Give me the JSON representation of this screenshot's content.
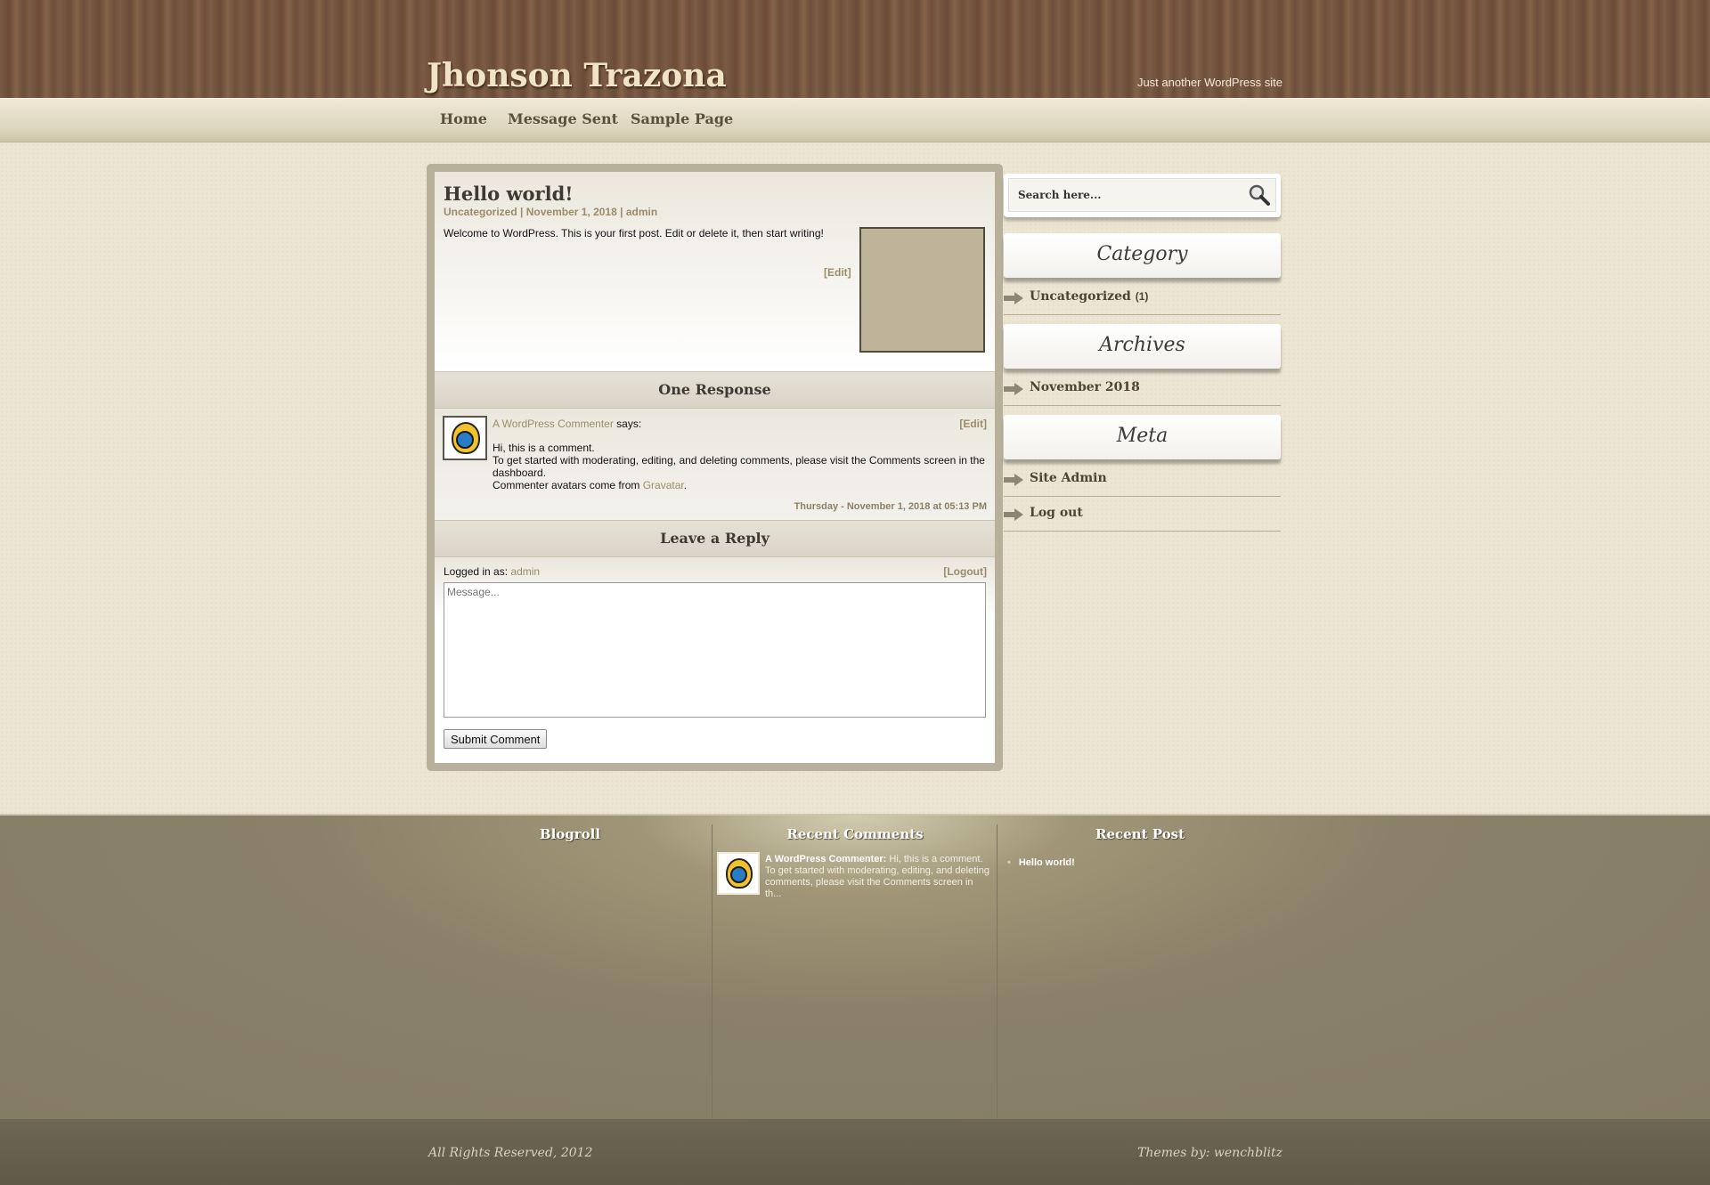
{
  "header": {
    "site_title": "Jhonson Trazona",
    "tagline": "Just another WordPress site"
  },
  "nav": {
    "items": [
      {
        "label": "Home"
      },
      {
        "label": "Message Sent"
      },
      {
        "label": "Sample Page"
      }
    ]
  },
  "post": {
    "title": "Hello world!",
    "category": "Uncategorized",
    "date": "November 1, 2018",
    "author": "admin",
    "separator": " | ",
    "body": "Welcome to WordPress. This is your first post. Edit or delete it, then start writing!",
    "edit_label": "[Edit]"
  },
  "comments": {
    "heading": "One Response",
    "items": [
      {
        "author": "A WordPress Commenter",
        "says": " says:",
        "edit_label": "[Edit]",
        "line1": "Hi, this is a comment.",
        "line2": "To get started with moderating, editing, and deleting comments, please visit the Comments screen in the dashboard.",
        "line3_prefix": "Commenter avatars come from ",
        "line3_link": "Gravatar",
        "line3_suffix": ".",
        "date": "Thursday - November 1, 2018 at 05:13 PM"
      }
    ]
  },
  "reply": {
    "heading": "Leave a Reply",
    "logged_in_prefix": "Logged in as: ",
    "logged_in_user": "admin",
    "logout_label": "[Logout]",
    "message_placeholder": "Message...",
    "submit_label": "Submit Comment"
  },
  "sidebar": {
    "search_placeholder": "Search here...",
    "widgets": [
      {
        "title": "Category",
        "items": [
          {
            "label": "Uncategorized",
            "count": "(1)"
          }
        ]
      },
      {
        "title": "Archives",
        "items": [
          {
            "label": "November 2018"
          }
        ]
      },
      {
        "title": "Meta",
        "items": [
          {
            "label": "Site Admin"
          },
          {
            "label": "Log out"
          }
        ]
      }
    ]
  },
  "footer": {
    "columns": [
      {
        "title": "Blogroll"
      },
      {
        "title": "Recent Comments"
      },
      {
        "title": "Recent Post"
      }
    ],
    "recent_comment": {
      "author": "A WordPress Commenter:",
      "excerpt": " Hi, this is a comment. To get started with moderating, editing, and deleting comments, please visit the Comments screen in th..."
    },
    "recent_posts": [
      "Hello world!"
    ]
  },
  "bottom": {
    "copyright": "All Rights Reserved, 2012",
    "credit": "Themes by: wenchblitz"
  },
  "colors": {
    "accent": "#9b8c69",
    "header_wood": "#7a5a44",
    "footer": "#8a8168"
  }
}
